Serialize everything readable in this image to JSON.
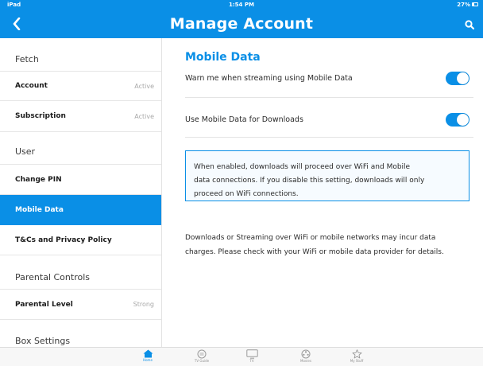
{
  "status_bar": {
    "carrier": "iPad",
    "time": "1:54 PM",
    "battery": "27%"
  },
  "nav": {
    "title": "Manage Account"
  },
  "sidebar": {
    "fetch_section": "Fetch",
    "account": {
      "label": "Account",
      "status": "Active"
    },
    "subscription": {
      "label": "Subscription",
      "status": "Active"
    },
    "user_section": "User",
    "change_pin": "Change PIN",
    "mobile_data": "Mobile Data",
    "terms": "T&Cs and Privacy Policy",
    "parental_section": "Parental Controls",
    "parental_level": {
      "label": "Parental Level",
      "status": "Strong"
    },
    "box_section": "Box Settings"
  },
  "main": {
    "title": "Mobile Data",
    "streaming_warning": {
      "label": "Warn me when streaming using Mobile Data",
      "enabled": true
    },
    "downloads": {
      "label": "Use Mobile Data for Downloads",
      "enabled": true
    },
    "info_lines": [
      "When enabled, downloads will proceed over WiFi and Mobile",
      "data connections. If you disable this setting, downloads will only",
      "proceed on WiFi connections."
    ],
    "disclaimer_lines": [
      "Downloads or Streaming over WiFi or mobile networks may incur data",
      "charges. Please check with your WiFi or mobile data provider for details."
    ]
  },
  "tabs": [
    {
      "label": "Home",
      "icon": "home-icon",
      "active": true
    },
    {
      "label": "TV Guide",
      "icon": "tv-guide-icon",
      "active": false
    },
    {
      "label": "TV",
      "icon": "tv-icon",
      "active": false
    },
    {
      "label": "Movies",
      "icon": "movies-icon",
      "active": false
    },
    {
      "label": "My Stuff",
      "icon": "star-icon",
      "active": false
    }
  ],
  "colors": {
    "accent": "#0a8fe6",
    "toggle_on": "#0a8fe6",
    "sidebar_selected": "#0a8fe6"
  }
}
